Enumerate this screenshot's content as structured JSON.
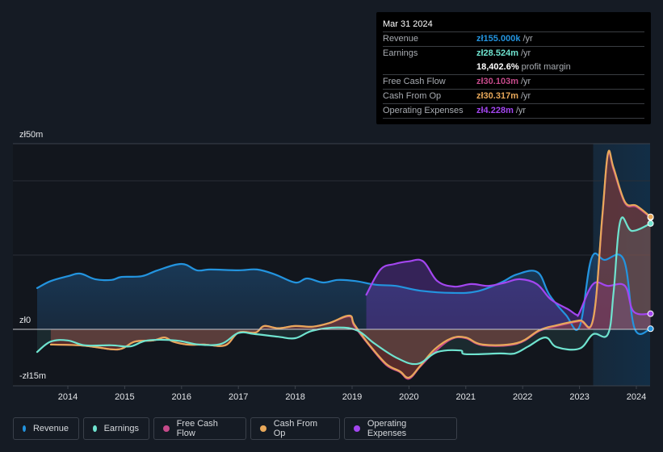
{
  "tooltip": {
    "date": "Mar 31 2024",
    "rows": [
      {
        "label": "Revenue",
        "value": "zł155.000k",
        "unit": "/yr",
        "color": "#2394df"
      },
      {
        "label": "Earnings",
        "value": "zł28.524m",
        "unit": "/yr",
        "color": "#6fe3cf"
      },
      {
        "label": "",
        "value": "18,402.6%",
        "unit": "profit margin",
        "color": "#ffffff"
      },
      {
        "label": "Free Cash Flow",
        "value": "zł30.103m",
        "unit": "/yr",
        "color": "#c54a8a"
      },
      {
        "label": "Cash From Op",
        "value": "zł30.317m",
        "unit": "/yr",
        "color": "#e8a85a"
      },
      {
        "label": "Operating Expenses",
        "value": "zł4.228m",
        "unit": "/yr",
        "color": "#a346f0"
      }
    ]
  },
  "legend": [
    {
      "label": "Revenue",
      "color": "#2394df"
    },
    {
      "label": "Earnings",
      "color": "#6fe3cf"
    },
    {
      "label": "Free Cash Flow",
      "color": "#c54a8a"
    },
    {
      "label": "Cash From Op",
      "color": "#e8a85a"
    },
    {
      "label": "Operating Expenses",
      "color": "#a346f0"
    }
  ],
  "chart_data": {
    "type": "area",
    "title": "",
    "xlabel": "",
    "ylabel": "",
    "currency": "zł",
    "y_ticks": [
      {
        "value": 50,
        "label": "zł50m"
      },
      {
        "value": 0,
        "label": "zł0"
      },
      {
        "value": -15,
        "label": "-zł15m"
      }
    ],
    "gridlines": [
      50,
      40,
      20,
      0
    ],
    "ylim": [
      -15,
      50
    ],
    "xlim": [
      2013.5,
      2024.25
    ],
    "x_ticks": [
      "2014",
      "2015",
      "2016",
      "2017",
      "2018",
      "2019",
      "2020",
      "2021",
      "2022",
      "2023",
      "2024"
    ],
    "highlight_range": [
      2023.24,
      2024.25
    ],
    "series": [
      {
        "name": "Revenue",
        "color": "#2394df",
        "points": [
          [
            2013.46,
            11.1
          ],
          [
            2013.7,
            13.0
          ],
          [
            2014.0,
            14.3
          ],
          [
            2014.22,
            15.0
          ],
          [
            2014.48,
            13.5
          ],
          [
            2014.77,
            13.3
          ],
          [
            2014.94,
            14.1
          ],
          [
            2015.3,
            14.3
          ],
          [
            2015.58,
            15.9
          ],
          [
            2016.0,
            17.6
          ],
          [
            2016.27,
            15.9
          ],
          [
            2016.51,
            16.1
          ],
          [
            2017.0,
            15.9
          ],
          [
            2017.33,
            16.1
          ],
          [
            2017.64,
            14.8
          ],
          [
            2018.0,
            12.6
          ],
          [
            2018.21,
            13.7
          ],
          [
            2018.49,
            12.6
          ],
          [
            2018.75,
            13.3
          ],
          [
            2019.06,
            13.0
          ],
          [
            2019.42,
            12.0
          ],
          [
            2019.77,
            11.7
          ],
          [
            2020.2,
            10.4
          ],
          [
            2020.77,
            9.8
          ],
          [
            2021.19,
            10.2
          ],
          [
            2021.62,
            12.6
          ],
          [
            2021.9,
            14.8
          ],
          [
            2022.26,
            15.4
          ],
          [
            2022.47,
            9.3
          ],
          [
            2022.76,
            3.9
          ],
          [
            2023.0,
            0.7
          ],
          [
            2023.21,
            19.1
          ],
          [
            2023.44,
            18.7
          ],
          [
            2023.78,
            18.7
          ],
          [
            2023.97,
            0.2
          ],
          [
            2024.25,
            0.155
          ]
        ]
      },
      {
        "name": "Earnings",
        "color": "#6fe3cf",
        "points": [
          [
            2013.46,
            -6.1
          ],
          [
            2013.7,
            -3.3
          ],
          [
            2014.0,
            -3.0
          ],
          [
            2014.3,
            -4.3
          ],
          [
            2014.77,
            -4.3
          ],
          [
            2015.1,
            -4.6
          ],
          [
            2015.4,
            -3.0
          ],
          [
            2015.9,
            -3.0
          ],
          [
            2016.3,
            -4.1
          ],
          [
            2016.7,
            -3.9
          ],
          [
            2017.0,
            -1.0
          ],
          [
            2017.3,
            -1.3
          ],
          [
            2017.7,
            -2.0
          ],
          [
            2018.0,
            -2.4
          ],
          [
            2018.3,
            -0.4
          ],
          [
            2018.75,
            0.5
          ],
          [
            2019.1,
            -0.4
          ],
          [
            2019.4,
            -3.9
          ],
          [
            2019.8,
            -7.8
          ],
          [
            2020.15,
            -9.3
          ],
          [
            2020.5,
            -6.1
          ],
          [
            2020.9,
            -5.7
          ],
          [
            2021.0,
            -6.7
          ],
          [
            2021.6,
            -6.5
          ],
          [
            2021.86,
            -6.5
          ],
          [
            2022.1,
            -4.6
          ],
          [
            2022.4,
            -2.2
          ],
          [
            2022.6,
            -4.8
          ],
          [
            2023.0,
            -5.2
          ],
          [
            2023.24,
            -1.3
          ],
          [
            2023.5,
            -1.3
          ],
          [
            2023.6,
            10.0
          ],
          [
            2023.72,
            29.3
          ],
          [
            2023.92,
            26.5
          ],
          [
            2024.25,
            28.5
          ]
        ]
      },
      {
        "name": "Free Cash Flow",
        "color": "#c54a8a",
        "points": [
          [
            2013.7,
            -4.1
          ],
          [
            2014.2,
            -4.3
          ],
          [
            2014.5,
            -4.8
          ],
          [
            2014.9,
            -5.4
          ],
          [
            2015.18,
            -3.3
          ],
          [
            2015.5,
            -3.0
          ],
          [
            2015.7,
            -2.2
          ],
          [
            2015.85,
            -3.3
          ],
          [
            2016.1,
            -4.1
          ],
          [
            2016.4,
            -4.1
          ],
          [
            2016.77,
            -4.3
          ],
          [
            2017.0,
            -0.9
          ],
          [
            2017.3,
            -0.9
          ],
          [
            2017.45,
            0.9
          ],
          [
            2017.7,
            0.3
          ],
          [
            2018.0,
            0.9
          ],
          [
            2018.3,
            0.7
          ],
          [
            2018.6,
            1.7
          ],
          [
            2018.95,
            3.5
          ],
          [
            2019.04,
            0.9
          ],
          [
            2019.3,
            -4.3
          ],
          [
            2019.6,
            -9.6
          ],
          [
            2019.84,
            -11.5
          ],
          [
            2020.0,
            -13.3
          ],
          [
            2020.2,
            -10.0
          ],
          [
            2020.45,
            -6.1
          ],
          [
            2020.75,
            -2.6
          ],
          [
            2021.0,
            -2.4
          ],
          [
            2021.3,
            -4.3
          ],
          [
            2021.9,
            -3.9
          ],
          [
            2022.3,
            -0.4
          ],
          [
            2022.6,
            0.9
          ],
          [
            2023.0,
            2.2
          ],
          [
            2023.24,
            2.6
          ],
          [
            2023.4,
            30.0
          ],
          [
            2023.5,
            47.0
          ],
          [
            2023.6,
            43.0
          ],
          [
            2023.8,
            34.0
          ],
          [
            2024.0,
            33.0
          ],
          [
            2024.25,
            30.1
          ]
        ]
      },
      {
        "name": "Cash From Op",
        "color": "#e8a85a",
        "points": [
          [
            2013.7,
            -4.1
          ],
          [
            2014.2,
            -4.3
          ],
          [
            2014.5,
            -4.8
          ],
          [
            2014.9,
            -5.4
          ],
          [
            2015.18,
            -3.3
          ],
          [
            2015.5,
            -3.0
          ],
          [
            2015.7,
            -2.2
          ],
          [
            2015.85,
            -3.3
          ],
          [
            2016.1,
            -4.1
          ],
          [
            2016.4,
            -4.1
          ],
          [
            2016.77,
            -4.3
          ],
          [
            2017.0,
            -0.9
          ],
          [
            2017.3,
            -0.9
          ],
          [
            2017.45,
            0.9
          ],
          [
            2017.7,
            0.3
          ],
          [
            2018.0,
            0.9
          ],
          [
            2018.3,
            0.7
          ],
          [
            2018.6,
            1.7
          ],
          [
            2018.95,
            3.7
          ],
          [
            2019.04,
            1.3
          ],
          [
            2019.3,
            -4.1
          ],
          [
            2019.6,
            -9.3
          ],
          [
            2019.84,
            -11.3
          ],
          [
            2020.0,
            -13.0
          ],
          [
            2020.2,
            -9.8
          ],
          [
            2020.45,
            -5.4
          ],
          [
            2020.75,
            -2.4
          ],
          [
            2021.0,
            -2.2
          ],
          [
            2021.3,
            -4.1
          ],
          [
            2021.9,
            -3.7
          ],
          [
            2022.3,
            -0.2
          ],
          [
            2022.6,
            1.1
          ],
          [
            2023.0,
            2.4
          ],
          [
            2023.24,
            2.8
          ],
          [
            2023.4,
            30.5
          ],
          [
            2023.5,
            47.4
          ],
          [
            2023.6,
            43.5
          ],
          [
            2023.8,
            34.3
          ],
          [
            2024.0,
            33.3
          ],
          [
            2024.25,
            30.3
          ]
        ]
      },
      {
        "name": "Operating Expenses",
        "color": "#a346f0",
        "points": [
          [
            2019.25,
            9.3
          ],
          [
            2019.5,
            16.1
          ],
          [
            2019.75,
            17.6
          ],
          [
            2020.0,
            18.3
          ],
          [
            2020.25,
            18.3
          ],
          [
            2020.5,
            13.0
          ],
          [
            2020.8,
            11.5
          ],
          [
            2021.1,
            12.2
          ],
          [
            2021.4,
            11.7
          ],
          [
            2021.7,
            12.6
          ],
          [
            2021.95,
            13.5
          ],
          [
            2022.25,
            12.2
          ],
          [
            2022.5,
            8.0
          ],
          [
            2022.8,
            5.4
          ],
          [
            2022.95,
            3.9
          ],
          [
            2023.0,
            4.5
          ],
          [
            2023.24,
            12.2
          ],
          [
            2023.5,
            11.7
          ],
          [
            2023.8,
            11.7
          ],
          [
            2023.95,
            4.8
          ],
          [
            2024.25,
            4.2
          ]
        ]
      }
    ]
  }
}
